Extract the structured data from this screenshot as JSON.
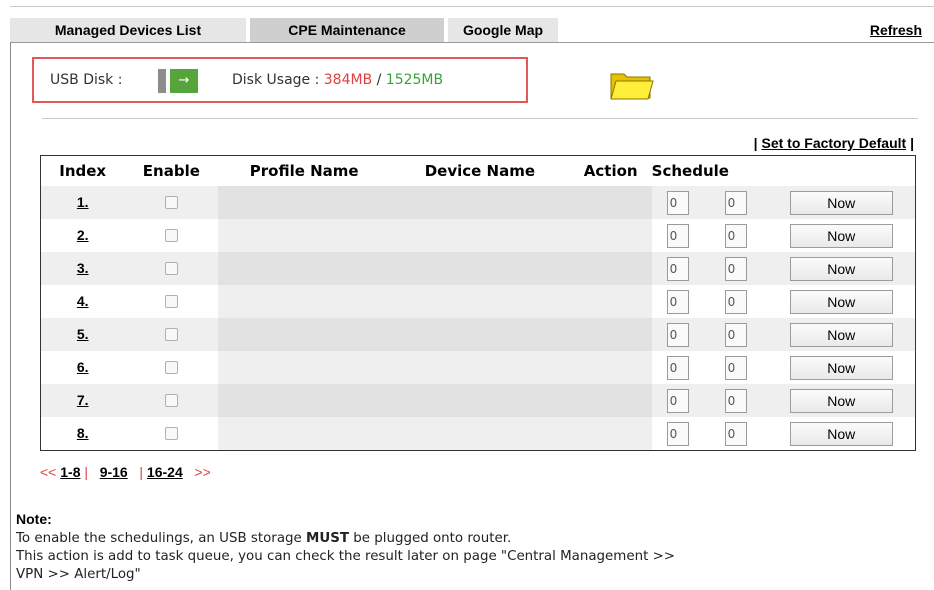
{
  "tabs": {
    "managed_devices": "Managed Devices List",
    "cpe_maintenance": "CPE Maintenance",
    "google_map": "Google Map",
    "refresh": "Refresh"
  },
  "usb": {
    "disk_label": "USB Disk :",
    "usage_label": "Disk Usage :",
    "used": "384MB",
    "separator": " / ",
    "total": "1525MB",
    "used_color": "#e0413f",
    "total_color": "#3ba13b",
    "icon": "usb-icon",
    "folder_icon": "folder-icon"
  },
  "actions": {
    "set_factory_default": "Set to Factory Default"
  },
  "table": {
    "headers": [
      "Index",
      "Enable",
      "Profile Name",
      "Device Name",
      "Action",
      "Schedule"
    ],
    "rows": [
      {
        "index": "1.",
        "enabled": false,
        "profile": "",
        "device": "",
        "action": "",
        "sched_a": "0",
        "sched_b": "0",
        "button": "Now"
      },
      {
        "index": "2.",
        "enabled": false,
        "profile": "",
        "device": "",
        "action": "",
        "sched_a": "0",
        "sched_b": "0",
        "button": "Now"
      },
      {
        "index": "3.",
        "enabled": false,
        "profile": "",
        "device": "",
        "action": "",
        "sched_a": "0",
        "sched_b": "0",
        "button": "Now"
      },
      {
        "index": "4.",
        "enabled": false,
        "profile": "",
        "device": "",
        "action": "",
        "sched_a": "0",
        "sched_b": "0",
        "button": "Now"
      },
      {
        "index": "5.",
        "enabled": false,
        "profile": "",
        "device": "",
        "action": "",
        "sched_a": "0",
        "sched_b": "0",
        "button": "Now"
      },
      {
        "index": "6.",
        "enabled": false,
        "profile": "",
        "device": "",
        "action": "",
        "sched_a": "0",
        "sched_b": "0",
        "button": "Now"
      },
      {
        "index": "7.",
        "enabled": false,
        "profile": "",
        "device": "",
        "action": "",
        "sched_a": "0",
        "sched_b": "0",
        "button": "Now"
      },
      {
        "index": "8.",
        "enabled": false,
        "profile": "",
        "device": "",
        "action": "",
        "sched_a": "0",
        "sched_b": "0",
        "button": "Now"
      }
    ]
  },
  "pager": {
    "prev": "<<",
    "page1": "1-8",
    "page2": "9-16",
    "page3": "16-24",
    "next": ">>"
  },
  "note": {
    "title": "Note:",
    "line1_pre": "To enable the schedulings, an USB storage ",
    "line1_bold": "MUST",
    "line1_post": " be plugged onto router.",
    "line2": "This action is add to task queue, you can check the result later on page \"Central Management >>",
    "line3": "VPN >> Alert/Log\""
  }
}
